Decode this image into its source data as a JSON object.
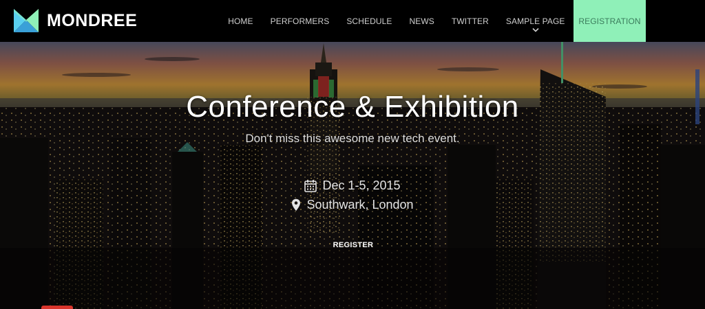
{
  "brand": {
    "name": "MONDREE",
    "logo_icon": "mondree-logo-icon",
    "logo_colors": [
      "#5ad0f0",
      "#8ff0b8",
      "#3aa0d8"
    ]
  },
  "nav": {
    "items": [
      {
        "label": "HOME"
      },
      {
        "label": "PERFORMERS"
      },
      {
        "label": "SCHEDULE"
      },
      {
        "label": "NEWS"
      },
      {
        "label": "TWITTER"
      },
      {
        "label": "SAMPLE PAGE",
        "has_dropdown": true,
        "dropdown_icon": "chevron-down-icon"
      },
      {
        "label": "REGISTRATION",
        "active": true
      }
    ],
    "active_color": "#8ff0b8"
  },
  "hero": {
    "title": "Conference & Exhibition",
    "subtitle": "Don't miss this awesome new tech event.",
    "date": "Dec 1-5, 2015",
    "date_icon": "calendar-icon",
    "location": "Southwark, London",
    "location_icon": "map-pin-icon",
    "cta_label": "REGISTER",
    "background": "city-skyline-night-image"
  }
}
